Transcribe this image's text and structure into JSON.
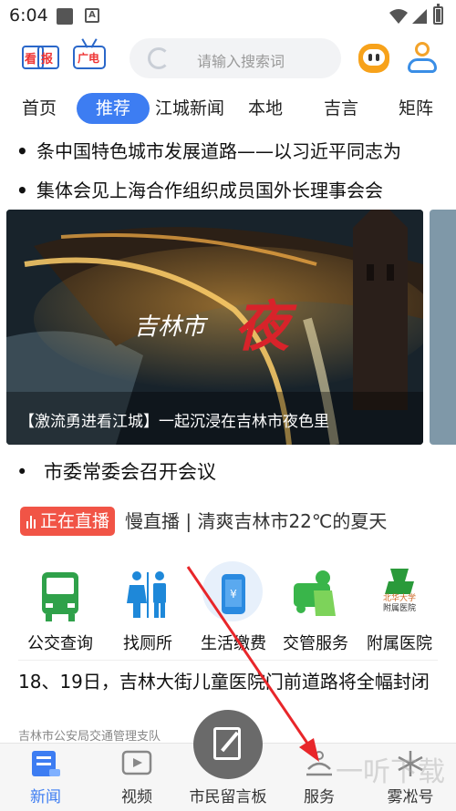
{
  "status_bar": {
    "time": "6:04"
  },
  "header": {
    "logo_kan": "看",
    "logo_bao": "报",
    "logo_guangdian": "广电",
    "search_placeholder": "请输入搜索词"
  },
  "tabs": [
    {
      "label": "首页"
    },
    {
      "label": "推荐",
      "active": true
    },
    {
      "label": "江城新闻"
    },
    {
      "label": "本地"
    },
    {
      "label": "吉言"
    },
    {
      "label": "矩阵"
    }
  ],
  "headlines": [
    {
      "bullet": "•",
      "text": "条中国特色城市发展道路——以习近平同志为"
    },
    {
      "bullet": "•",
      "text": "集体会见上海合作组织成员国外长理事会会"
    }
  ],
  "banner": {
    "logo_text": "吉林市",
    "logo_big": "夜",
    "caption": "【激流勇进看江城】一起沉浸在吉林市夜色里"
  },
  "news_item": {
    "bullet": "•",
    "text": "市委常委会召开会议"
  },
  "live": {
    "badge": "正在直播",
    "text": "慢直播 | 清爽吉林市22℃的夏天",
    "badge_color": "#f15446"
  },
  "services": [
    {
      "label": "公交查询",
      "icon": "bus-icon"
    },
    {
      "label": "找厕所",
      "icon": "toilet-icon"
    },
    {
      "label": "生活缴费",
      "icon": "phone-payment-icon"
    },
    {
      "label": "交管服务",
      "icon": "traffic-police-icon"
    },
    {
      "label": "附属医院",
      "icon": "hospital-logo-icon",
      "logo_top": "北华大学",
      "logo_bottom": "附属医院"
    }
  ],
  "news2": {
    "title": "18、19日，吉林大街儿童医院门前道路将全幅封闭",
    "source": "吉林市公安局交通管理支队"
  },
  "bottom_nav": [
    {
      "label": "新闻",
      "icon": "news-icon",
      "active": true
    },
    {
      "label": "视频",
      "icon": "video-icon"
    },
    {
      "label": "市民留言板",
      "icon": "message-board-icon"
    },
    {
      "label": "服务",
      "icon": "service-icon"
    },
    {
      "label": "雾凇号",
      "icon": "snowflake-icon"
    }
  ],
  "watermark": "一听下载",
  "colors": {
    "accent": "#3d7df2",
    "live": "#f15446",
    "arrow": "#e8262a"
  }
}
